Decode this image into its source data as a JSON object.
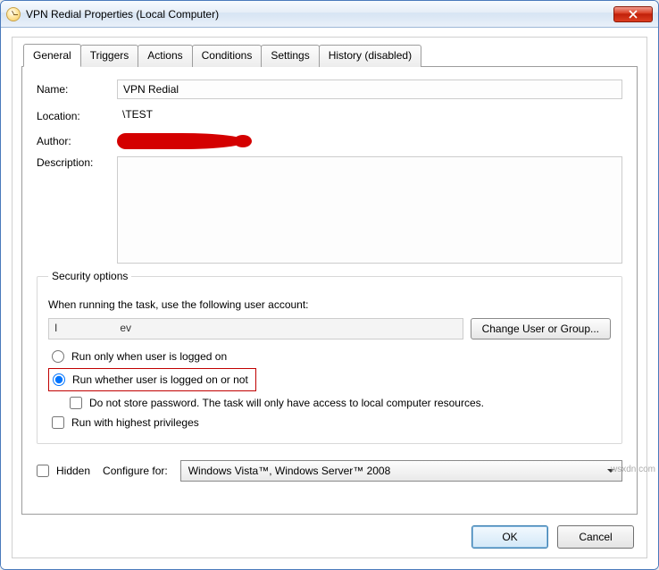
{
  "window": {
    "title": "VPN Redial Properties (Local Computer)"
  },
  "tabs": {
    "general": "General",
    "triggers": "Triggers",
    "actions": "Actions",
    "conditions": "Conditions",
    "settings": "Settings",
    "history": "History (disabled)"
  },
  "general": {
    "name_label": "Name:",
    "name_value": "VPN Redial",
    "location_label": "Location:",
    "location_value": "\\TEST",
    "author_label": "Author:",
    "description_label": "Description:",
    "description_value": ""
  },
  "security": {
    "legend": "Security options",
    "running_as": "When running the task, use the following user account:",
    "account_part1": "I",
    "account_part2": "ev",
    "change_btn": "Change User or Group...",
    "radio_logged_on": "Run only when user is logged on",
    "radio_whether": "Run whether user is logged on or not",
    "no_store_pw": "Do not store password.  The task will only have access to local computer resources.",
    "highest_priv": "Run with highest privileges"
  },
  "footer": {
    "hidden": "Hidden",
    "configure_for": "Configure for:",
    "configure_value": "Windows Vista™, Windows Server™ 2008",
    "ok": "OK",
    "cancel": "Cancel"
  },
  "watermark": "wsxdn.com"
}
